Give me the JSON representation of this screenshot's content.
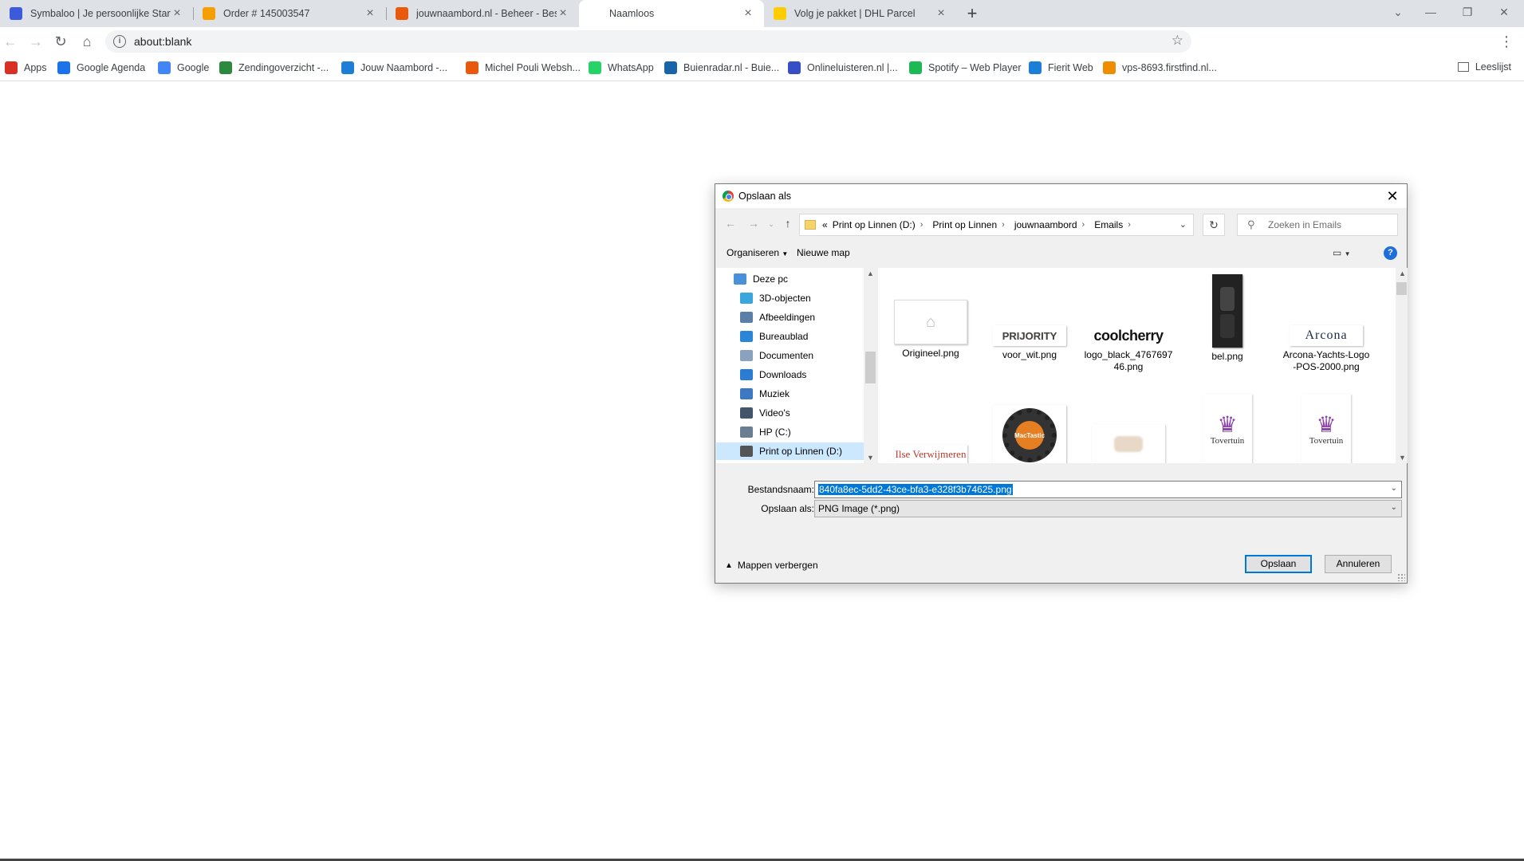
{
  "browser": {
    "tabs": [
      {
        "title": "Symbaloo | Je persoonlijke Startp",
        "color": "#3b5bdb"
      },
      {
        "title": "Order # 145003547",
        "color": "#f59f00"
      },
      {
        "title": "jouwnaambord.nl - Beheer - Best",
        "color": "#e8590c"
      },
      {
        "title": "Naamloos",
        "color": "#ffffff"
      },
      {
        "title": "Volg je pakket | DHL Parcel",
        "color": "#ffcc00"
      }
    ],
    "active_tab_index": 3,
    "url": "about:blank",
    "bookmarks": [
      {
        "label": "Apps",
        "color": "#d93025"
      },
      {
        "label": "Google Agenda",
        "color": "#1a73e8"
      },
      {
        "label": "Google",
        "color": "#4285f4"
      },
      {
        "label": "Zendingoverzicht -...",
        "color": "#2b8a3e"
      },
      {
        "label": "Jouw Naambord -...",
        "color": "#1c7ed6"
      },
      {
        "label": "Michel Pouli Websh...",
        "color": "#e8590c"
      },
      {
        "label": "WhatsApp",
        "color": "#25d366"
      },
      {
        "label": "Buienradar.nl - Buie...",
        "color": "#1864ab"
      },
      {
        "label": "Onlineluisteren.nl |...",
        "color": "#364fc7"
      },
      {
        "label": "Spotify – Web Player",
        "color": "#1db954"
      },
      {
        "label": "Fierit Web",
        "color": "#1c7ed6"
      },
      {
        "label": "vps-8693.firstfind.nl...",
        "color": "#f08c00"
      }
    ],
    "reading_list": "Leeslijst"
  },
  "dialog": {
    "title": "Opslaan als",
    "breadcrumbs": [
      "Print op Linnen (D:)",
      "Print op Linnen",
      "jouwnaambord",
      "Emails"
    ],
    "breadcrumb_prefix": "«",
    "search_placeholder": "Zoeken in Emails",
    "organize_label": "Organiseren",
    "new_folder_label": "Nieuwe map",
    "nav_items": [
      {
        "label": "Deze pc",
        "icon": "pc-icon",
        "color": "#4a90d9"
      },
      {
        "label": "3D-objecten",
        "icon": "cube-icon",
        "color": "#3aa6dd"
      },
      {
        "label": "Afbeeldingen",
        "icon": "pictures-icon",
        "color": "#5b7fa6"
      },
      {
        "label": "Bureaublad",
        "icon": "desktop-icon",
        "color": "#2b86d8"
      },
      {
        "label": "Documenten",
        "icon": "documents-icon",
        "color": "#8aa2bd"
      },
      {
        "label": "Downloads",
        "icon": "download-icon",
        "color": "#2b7cd3"
      },
      {
        "label": "Muziek",
        "icon": "music-icon",
        "color": "#3d79c2"
      },
      {
        "label": "Video's",
        "icon": "video-icon",
        "color": "#44546a"
      },
      {
        "label": "HP (C:)",
        "icon": "drive-icon",
        "color": "#6b7d91"
      },
      {
        "label": "Print op Linnen (D:)",
        "icon": "drive-icon",
        "color": "#555555"
      }
    ],
    "selected_nav_index": 9,
    "files": [
      {
        "name": "Origineel.png",
        "thumb_text": "",
        "thumb_kind": "house"
      },
      {
        "name": "voor_wit.png",
        "thumb_text": "PRIJORITY",
        "thumb_kind": "logo"
      },
      {
        "name": "logo_black_476769746.png",
        "thumb_text": "coolcherry",
        "thumb_kind": "wordmark"
      },
      {
        "name": "bel.png",
        "thumb_text": "",
        "thumb_kind": "doorbell"
      },
      {
        "name": "Arcona-Yachts-Logo-POS-2000.png",
        "thumb_text": "Arcona",
        "thumb_kind": "wordmark-thin"
      },
      {
        "name": "",
        "thumb_text": "Ilse Verwijmeren",
        "thumb_kind": "script"
      },
      {
        "name": "",
        "thumb_text": "MacTastic",
        "thumb_kind": "gear"
      },
      {
        "name": "",
        "thumb_text": "",
        "thumb_kind": "blur"
      },
      {
        "name": "",
        "thumb_text": "Tovertuin",
        "thumb_kind": "wizard"
      },
      {
        "name": "",
        "thumb_text": "Tovertuin",
        "thumb_kind": "wizard2"
      }
    ],
    "filename_label": "Bestandsnaam:",
    "filename_value": "840fa8ec-5dd2-43ce-bfa3-e328f3b74625.png",
    "savetype_label": "Opslaan als:",
    "savetype_value": "PNG Image (*.png)",
    "hide_folders_label": "Mappen verbergen",
    "save_button": "Opslaan",
    "cancel_button": "Annuleren"
  }
}
